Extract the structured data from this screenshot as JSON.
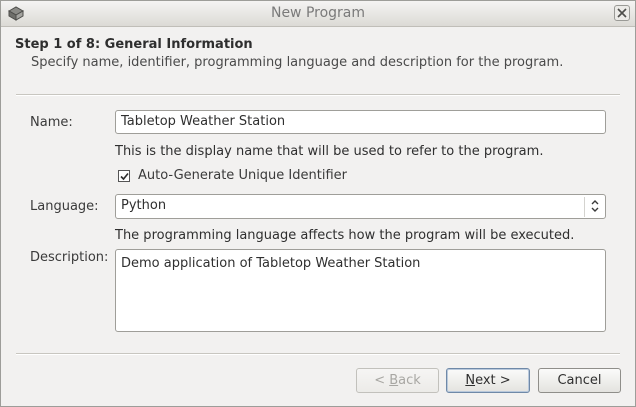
{
  "window": {
    "title": "New Program"
  },
  "header": {
    "step_title": "Step 1 of 8: General Information",
    "step_description": "Specify name, identifier, programming language and description for the program."
  },
  "form": {
    "name_label": "Name:",
    "name_value": "Tabletop Weather Station",
    "name_hint": "This is the display name that will be used to refer to the program.",
    "auto_id_checked": true,
    "auto_id_label": "Auto-Generate Unique Identifier",
    "language_label": "Language:",
    "language_value": "Python",
    "language_hint": "The programming language affects how the program will be executed.",
    "description_label": "Description:",
    "description_value": "Demo application of Tabletop Weather Station"
  },
  "buttons": {
    "back_prefix": "< ",
    "back_mnemonic": "B",
    "back_rest": "ack",
    "next_mnemonic": "N",
    "next_rest": "ext >",
    "cancel_label": "Cancel"
  },
  "icons": {
    "app": "app-window-icon",
    "close": "close-icon",
    "check": "checkmark-icon",
    "select": "up-down-arrows-icon"
  }
}
